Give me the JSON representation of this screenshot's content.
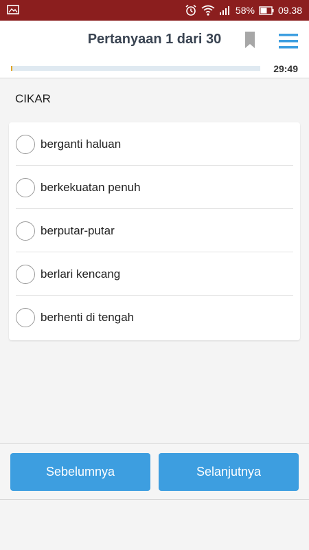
{
  "status_bar": {
    "battery_percent": "58%",
    "time": "09.38",
    "icons": [
      "image-icon",
      "alarm-icon",
      "wifi-icon",
      "signal-icon",
      "battery-icon"
    ],
    "background": "#8b1e1e"
  },
  "header": {
    "title": "Pertanyaan 1 dari 30",
    "timer": "29:49",
    "progress_fraction": 0.0333,
    "progress_color": "#e0a524",
    "bookmark_icon": "bookmark-icon",
    "menu_icon": "menu-icon",
    "accent": "#3d9ee0"
  },
  "question": {
    "text": "CIKAR",
    "options": [
      {
        "label": "berganti haluan"
      },
      {
        "label": "berkekuatan penuh"
      },
      {
        "label": "berputar-putar"
      },
      {
        "label": "berlari kencang"
      },
      {
        "label": "berhenti di tengah"
      }
    ]
  },
  "footer": {
    "prev_label": "Sebelumnya",
    "next_label": "Selanjutnya"
  }
}
